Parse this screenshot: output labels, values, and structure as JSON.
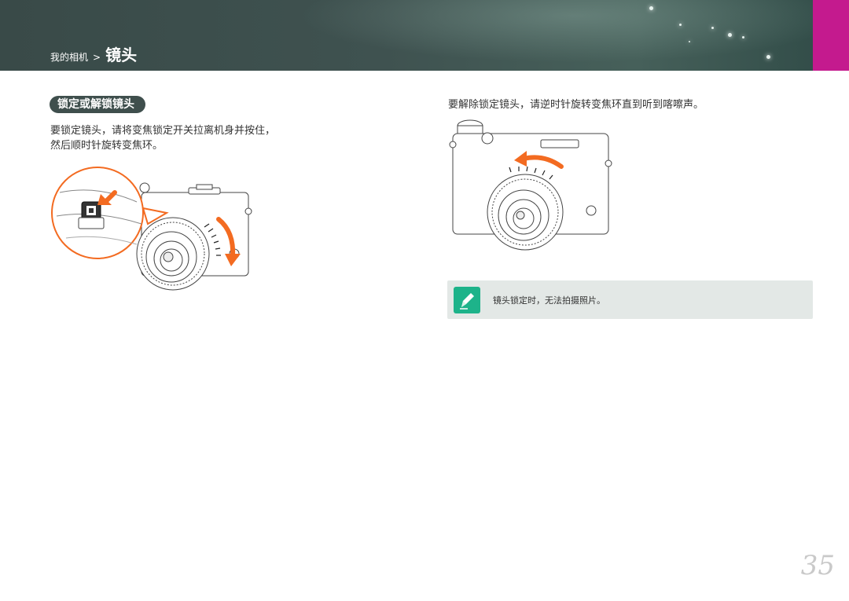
{
  "breadcrumb": {
    "parent": "我的相机",
    "separator": ">",
    "current": "镜头"
  },
  "section_title": "锁定或解锁镜头",
  "left_instruction": {
    "line1": "要锁定镜头，请将变焦锁定开关拉离机身并按住，",
    "line2": "然后顺时针旋转变焦环。"
  },
  "right_instruction": "要解除锁定镜头，请逆时针旋转变焦环直到听到喀嚓声。",
  "note": {
    "icon": "pencil-note-icon",
    "text": "镜头锁定时，无法拍摄照片。"
  },
  "page_number": "35",
  "colors": {
    "header": "#3f5250",
    "accent_magenta": "#c41a8e",
    "arrow_orange": "#f36b21",
    "note_green": "#1db38a",
    "note_bg": "#e3e8e6"
  }
}
